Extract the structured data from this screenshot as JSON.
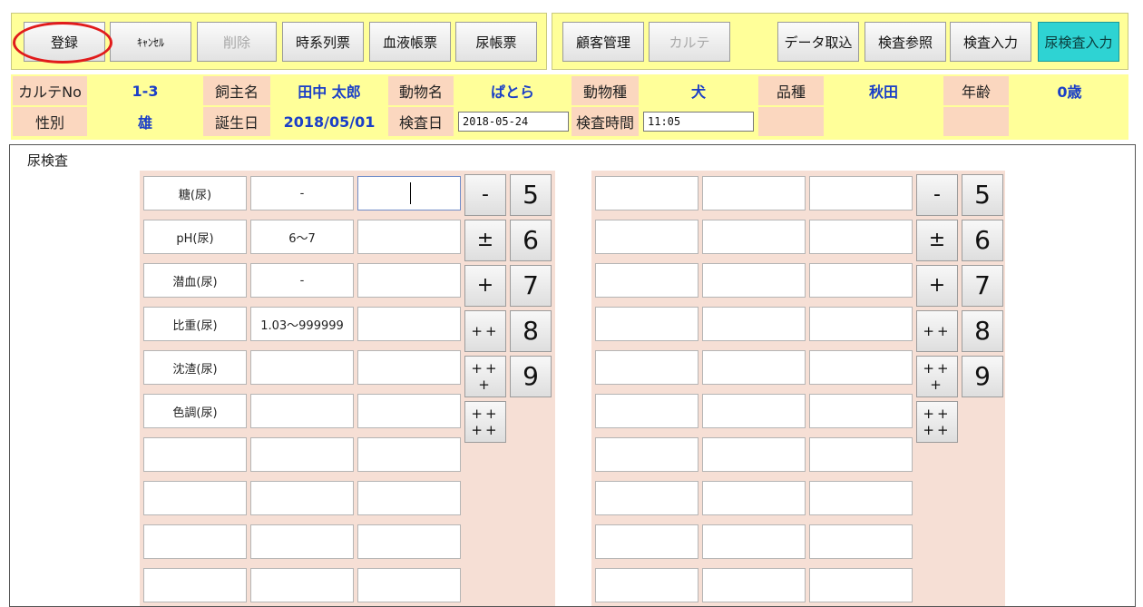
{
  "toolbar": {
    "left_buttons": [
      {
        "label": "登録",
        "state": "normal"
      },
      {
        "label": "ｷｬﾝｾﾙ",
        "state": "normal"
      },
      {
        "label": "削除",
        "state": "disabled"
      },
      {
        "label": "時系列票",
        "state": "normal"
      },
      {
        "label": "血液帳票",
        "state": "normal"
      },
      {
        "label": "尿帳票",
        "state": "normal"
      }
    ],
    "right_buttons": [
      {
        "label": "顧客管理",
        "state": "normal"
      },
      {
        "label": "カルテ",
        "state": "disabled"
      },
      {
        "label": "データ取込",
        "state": "normal"
      },
      {
        "label": "検査参照",
        "state": "normal"
      },
      {
        "label": "検査入力",
        "state": "normal"
      },
      {
        "label": "尿検査入力",
        "state": "active"
      }
    ],
    "highlight_color": "#e11b1b"
  },
  "info": {
    "row1": [
      {
        "label": "カルテNo",
        "value": "1-3"
      },
      {
        "label": "飼主名",
        "value": "田中 太郎"
      },
      {
        "label": "動物名",
        "value": "ぱとら"
      },
      {
        "label": "動物種",
        "value": "犬"
      },
      {
        "label": "品種",
        "value": "秋田"
      },
      {
        "label": "年齢",
        "value": "0歳"
      }
    ],
    "row2": {
      "sex_label": "性別",
      "sex": "雄",
      "birth_label": "誕生日",
      "birth": "2018/05/01",
      "date_label": "検査日",
      "date": "2018-05-24",
      "time_label": "検査時間",
      "time": "11:05"
    }
  },
  "main": {
    "section_title": "尿検査",
    "rows": [
      {
        "name": "糖(尿)",
        "ref": "-"
      },
      {
        "name": "pH(尿)",
        "ref": "6～7"
      },
      {
        "name": "潜血(尿)",
        "ref": "-"
      },
      {
        "name": "比重(尿)",
        "ref": "1.03～999999"
      },
      {
        "name": "沈渣(尿)",
        "ref": ""
      },
      {
        "name": "色調(尿)",
        "ref": ""
      }
    ],
    "sym_keys": [
      "-",
      "±",
      "+",
      "++",
      "+++",
      "++++"
    ],
    "num_keys": [
      "5",
      "6",
      "7",
      "8",
      "9"
    ]
  },
  "colors": {
    "toolbar_bg": "#ffff99",
    "label_bg": "#fbd7bf",
    "value_text": "#1b3fc7",
    "panel_bg": "#f6dfd5",
    "active_button": "#2ed3d3"
  }
}
